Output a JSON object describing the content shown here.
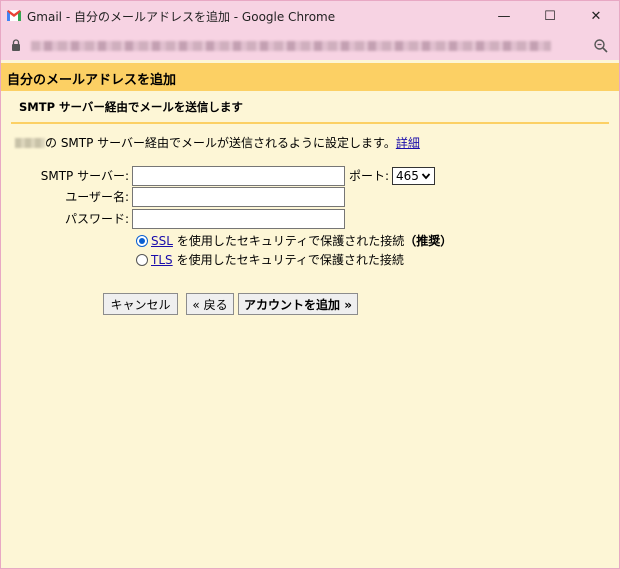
{
  "window": {
    "title": "Gmail - 自分のメールアドレスを追加 - Google Chrome",
    "minimize_glyph": "—",
    "maximize_glyph": "☐",
    "close_glyph": "✕"
  },
  "icons": {
    "app": "gmail-icon",
    "lock": "lock-icon",
    "zoom": "zoom-icon"
  },
  "page": {
    "header": "自分のメールアドレスを追加",
    "subheader": "SMTP サーバー経由でメールを送信します",
    "description_text": "の SMTP サーバー経由でメールが送信されるように設定します。",
    "description_link": "詳細"
  },
  "form": {
    "smtp_label": "SMTP サーバー:",
    "smtp_value": "",
    "port_label": "ポート:",
    "port_value": "465",
    "username_label": "ユーザー名:",
    "username_value": "",
    "password_label": "パスワード:",
    "password_value": "",
    "ssl": {
      "link": "SSL",
      "text": "を使用したセキュリティで保護された接続",
      "recommended": "（推奨）",
      "checked": true
    },
    "tls": {
      "link": "TLS",
      "text": "を使用したセキュリティで保護された接続",
      "checked": false
    }
  },
  "buttons": {
    "cancel": "キャンセル",
    "back": "« 戻る",
    "add_account": "アカウントを追加 »"
  },
  "colors": {
    "title_bar": "#f7d3e3",
    "header_band": "#fcd064",
    "page_background": "#fdf6d6",
    "link": "#1a0dab",
    "radio_accent": "#0a5fd1"
  }
}
